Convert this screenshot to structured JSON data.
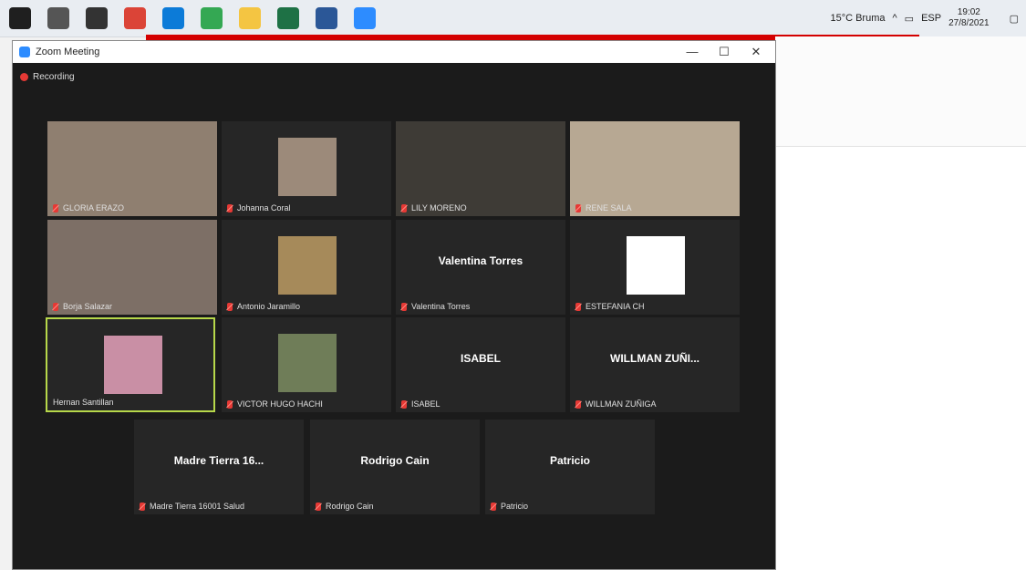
{
  "taskbar": {
    "weather": "15°C  Bruma",
    "language": "ESP",
    "time": "19:02",
    "date": "27/8/2021",
    "apps": [
      {
        "icon": "windows-start-icon",
        "color": "#1f1f1f"
      },
      {
        "icon": "search-icon",
        "color": "#555555"
      },
      {
        "icon": "store-icon",
        "color": "#333333"
      },
      {
        "icon": "chrome-icon",
        "color": "#db4437"
      },
      {
        "icon": "edge-icon",
        "color": "#0c7bd8"
      },
      {
        "icon": "chrome-icon-2",
        "color": "#34a853"
      },
      {
        "icon": "file-explorer-icon",
        "color": "#f4c542"
      },
      {
        "icon": "excel-icon",
        "color": "#1e7145"
      },
      {
        "icon": "word-icon",
        "color": "#2b5797"
      },
      {
        "icon": "zoom-icon",
        "color": "#2d8cff"
      }
    ]
  },
  "window": {
    "title": "Zoom Meeting",
    "recording_label": "Recording"
  },
  "participants": [
    {
      "name": "GLORIA ERAZO",
      "display": "",
      "video": true,
      "tone": "#8f7f70"
    },
    {
      "name": "Johanna Coral",
      "display": "",
      "video": true,
      "thumb": true,
      "tone": "#9c8a7a"
    },
    {
      "name": "LILY MORENO",
      "display": "",
      "video": true,
      "tone": "#3e3b36"
    },
    {
      "name": "RENE SALA",
      "display": "",
      "video": true,
      "tone": "#b7a893"
    },
    {
      "name": "Borja Salazar",
      "display": "",
      "video": true,
      "tone": "#7d6f66"
    },
    {
      "name": "Antonio Jaramillo",
      "display": "",
      "video": true,
      "thumb": true,
      "tone": "#a68a5a"
    },
    {
      "name": "Valentina Torres",
      "display": "Valentina Torres",
      "video": false
    },
    {
      "name": "ESTEFANIA CH",
      "display": "",
      "video": true,
      "thumb": true,
      "tone": "#ffffff"
    },
    {
      "name": "Hernan Santillan",
      "display": "",
      "video": true,
      "thumb": true,
      "tone": "#c98fa5",
      "active": true
    },
    {
      "name": "VICTOR HUGO HACHI",
      "display": "",
      "video": true,
      "thumb": true,
      "tone": "#6f7d58"
    },
    {
      "name": "ISABEL",
      "display": "ISABEL",
      "video": false
    },
    {
      "name": "WILLMAN ZUÑIGA",
      "display": "WILLMAN ZUÑI...",
      "video": false
    },
    {
      "name": "Madre Tierra 16001 Salud",
      "display": "Madre Tierra 16...",
      "video": false
    },
    {
      "name": "Rodrigo Cain",
      "display": "Rodrigo Cain",
      "video": false
    },
    {
      "name": "Patricio",
      "display": "Patricio",
      "video": false
    }
  ]
}
